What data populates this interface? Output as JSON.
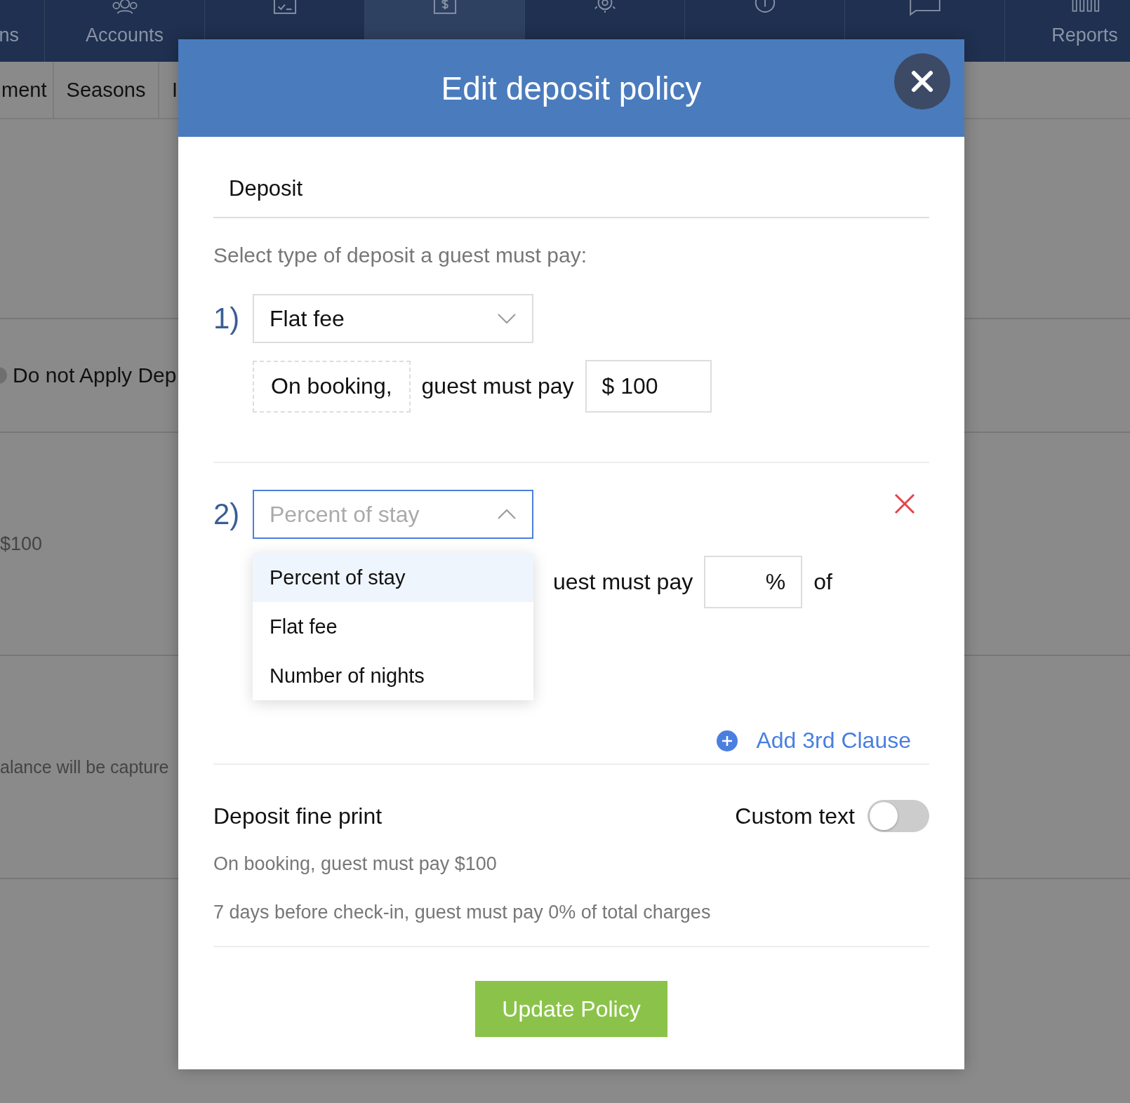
{
  "nav": {
    "items": [
      {
        "label": "ns",
        "selected": false
      },
      {
        "label": "Accounts",
        "selected": false
      },
      {
        "selected": false
      },
      {
        "selected": true
      },
      {
        "selected": false
      },
      {
        "selected": false
      },
      {
        "selected": false
      },
      {
        "label": "Reports",
        "selected": false
      }
    ]
  },
  "subnav": {
    "items": [
      "ment",
      "Seasons",
      "I"
    ]
  },
  "background": {
    "radio": {
      "label": "Do not Apply Dep",
      "checked": false
    },
    "amount": "$100",
    "note": "alance will be capture"
  },
  "modal": {
    "title": "Edit deposit policy",
    "tab": "Deposit",
    "prompt": "Select type of deposit a guest must pay:",
    "clauses": [
      {
        "number": "1)",
        "value": "Flat fee",
        "open": false,
        "timing": "On booking,",
        "text": "guest must pay",
        "prefix": "$",
        "amount": "100",
        "removable": false
      },
      {
        "number": "2)",
        "placeholder": "Percent of stay",
        "open": true,
        "options": [
          {
            "label": "Percent of stay",
            "selected": true
          },
          {
            "label": "Flat fee",
            "selected": false
          },
          {
            "label": "Number of nights",
            "selected": false
          }
        ],
        "text": "uest must pay",
        "unit": "%",
        "suffix": "of",
        "removable": true
      }
    ],
    "add_clause": "Add 3rd Clause",
    "fine_print": {
      "title": "Deposit fine print",
      "toggle_label": "Custom text",
      "on": false,
      "lines": [
        "On booking, guest must pay $100",
        "7 days before check-in, guest must pay 0% of total charges"
      ]
    },
    "submit": "Update Policy"
  }
}
